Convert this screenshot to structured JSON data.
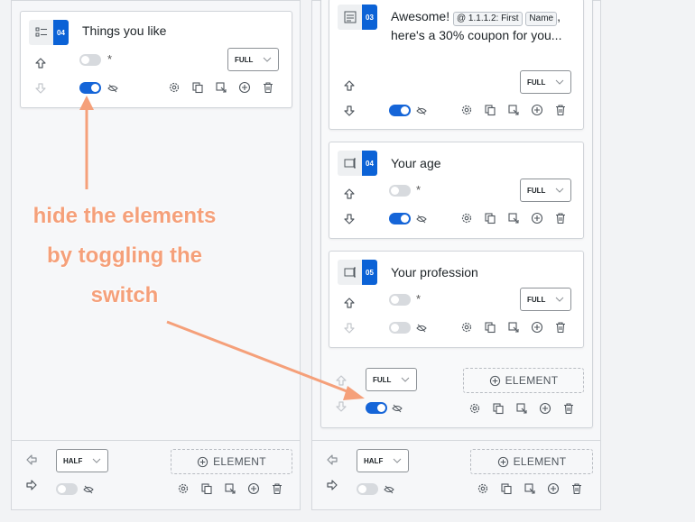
{
  "left_card": {
    "index": "04",
    "title": "Things you like",
    "width_select": "FULL"
  },
  "cards": [
    {
      "index": "03",
      "title_prefix": "Awesome!",
      "tag1": "@ 1.1.1.2: First",
      "tag2": "Name",
      "title_suffix": ", here's a 30% coupon for you...",
      "width_select": "FULL"
    },
    {
      "index": "04",
      "title": "Your age",
      "width_select": "FULL"
    },
    {
      "index": "05",
      "title": "Your profession",
      "width_select": "FULL"
    }
  ],
  "right_group_select": "FULL",
  "add_element_label": "ELEMENT",
  "bottom_left_select": "HALF",
  "bottom_right_select": "HALF",
  "annotation": {
    "line1": "hide the elements",
    "line2": "by toggling the",
    "line3": "switch"
  },
  "colors": {
    "accent": "#1565d8",
    "badge": "#0b62d6",
    "annotation": "#f5a07a"
  }
}
